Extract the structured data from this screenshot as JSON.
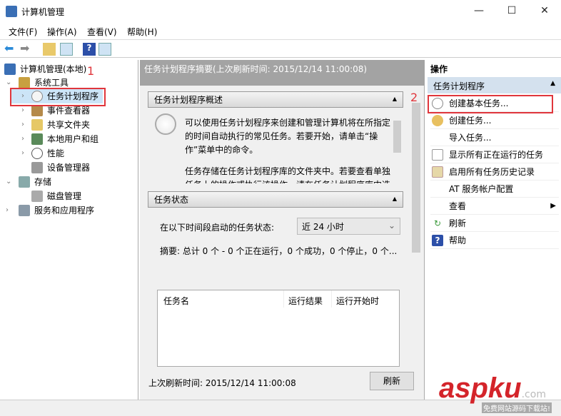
{
  "window": {
    "title": "计算机管理",
    "min": "—",
    "max": "☐",
    "close": "✕"
  },
  "menu": [
    "文件(F)",
    "操作(A)",
    "查看(V)",
    "帮助(H)"
  ],
  "tree": [
    {
      "label": "计算机管理(本地)"
    },
    {
      "label": "系统工具"
    },
    {
      "label": "任务计划程序"
    },
    {
      "label": "事件查看器"
    },
    {
      "label": "共享文件夹"
    },
    {
      "label": "本地用户和组"
    },
    {
      "label": "性能"
    },
    {
      "label": "设备管理器"
    },
    {
      "label": "存储"
    },
    {
      "label": "磁盘管理"
    },
    {
      "label": "服务和应用程序"
    }
  ],
  "annotations": {
    "one": "1",
    "two": "2"
  },
  "center": {
    "header": "任务计划程序摘要(上次刷新时间: 2015/12/14 11:00:08)",
    "overview": {
      "title": "任务计划程序概述",
      "p1": "可以使用任务计划程序来创建和管理计算机将在所指定的时间自动执行的常见任务。若要开始，请单击“操作”菜单中的命令。",
      "p2": "任务存储在任务计划程序库的文件夹中。若要查看单独任务上的操作或执行该操作，请在任务计划程序库中选择任务。"
    },
    "status": {
      "title": "任务状态",
      "period_label": "在以下时间段启动的任务状态:",
      "period_value": "近 24 小时",
      "summary": "摘要: 总计 0 个 - 0 个正在运行，0 个成功，0 个停止，0 个...",
      "columns": [
        "任务名",
        "运行结果",
        "运行开始时"
      ]
    },
    "last_refresh": "上次刷新时间: 2015/12/14 11:00:08",
    "refresh_button": "刷新"
  },
  "actions": {
    "header": "操作",
    "section": "任务计划程序",
    "items": [
      "创建基本任务...",
      "创建任务...",
      "导入任务...",
      "显示所有正在运行的任务",
      "启用所有任务历史记录",
      "AT 服务帐户配置",
      "查看",
      "刷新",
      "帮助"
    ]
  },
  "watermark": {
    "brand": "aspku",
    "suffix": ".com",
    "tagline": "免费网站源码下载站!"
  }
}
